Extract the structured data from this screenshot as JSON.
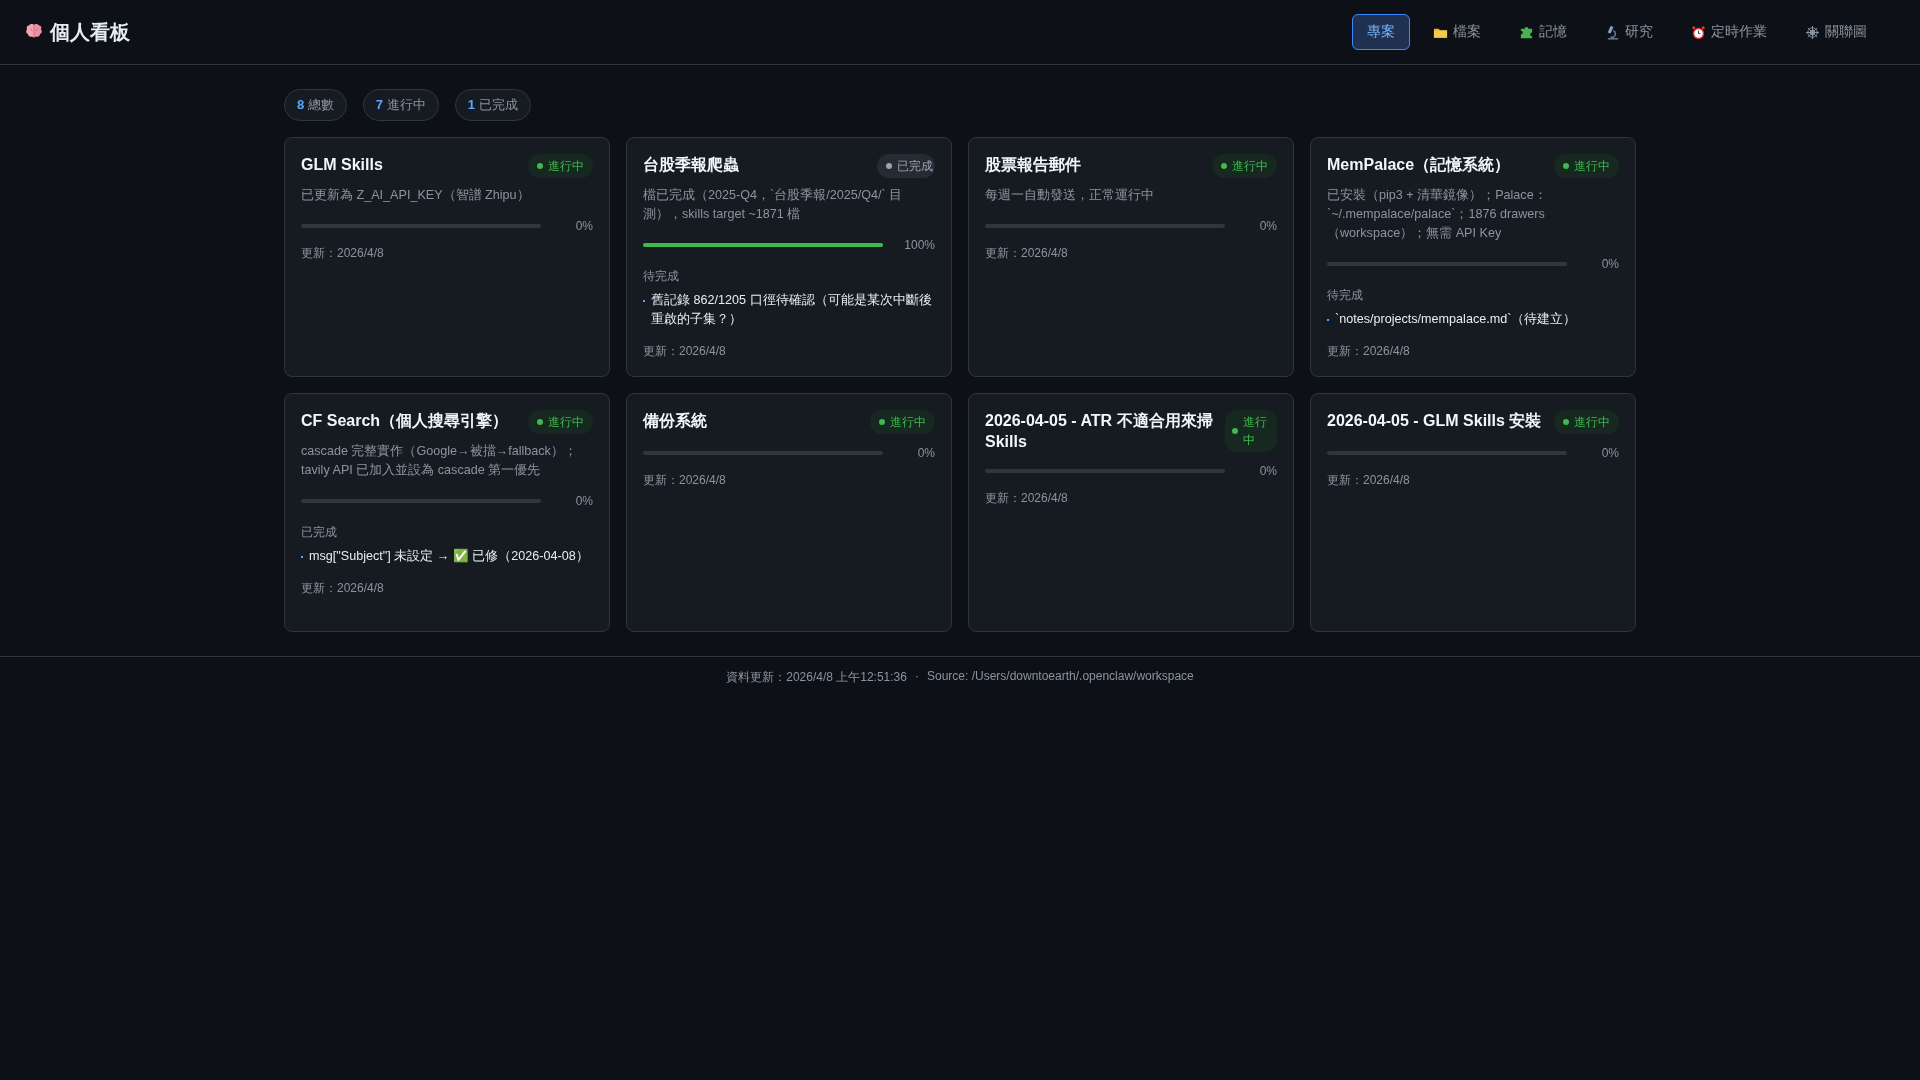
{
  "header": {
    "title": "個人看板"
  },
  "nav": [
    {
      "label": "專案",
      "selected": true
    },
    {
      "label": "檔案",
      "selected": false
    },
    {
      "label": "記憶",
      "selected": false
    },
    {
      "label": "研究",
      "selected": false
    },
    {
      "label": "定時作業",
      "selected": false
    },
    {
      "label": "關聯圖",
      "selected": false
    }
  ],
  "stats": [
    {
      "count": "8",
      "label": "總數"
    },
    {
      "count": "7",
      "label": "進行中"
    },
    {
      "count": "1",
      "label": "已完成"
    }
  ],
  "projects": [
    {
      "title": "GLM Skills",
      "status": {
        "label": "進行中",
        "kind": "active"
      },
      "description": "已更新為 Z_AI_API_KEY（智譜 Zhipu）",
      "level": 0,
      "percent": "0%",
      "updated": "更新：2026/4/8"
    },
    {
      "title": "台股季報爬蟲",
      "status": {
        "label": "已完成",
        "kind": "done"
      },
      "description": "檔已完成（2025-Q4，`台股季報/2025/Q4/` 目測），skills target ~1871 檔",
      "level": 1,
      "percent": "100%",
      "section": {
        "label": "待完成",
        "items": [
          "舊記錄 862/1205 口徑待確認（可能是某次中斷後重啟的子集？）"
        ]
      },
      "updated": "更新：2026/4/8"
    },
    {
      "title": "股票報告郵件",
      "status": {
        "label": "進行中",
        "kind": "active"
      },
      "description": "每週一自動發送，正常運行中",
      "level": 0,
      "percent": "0%",
      "updated": "更新：2026/4/8"
    },
    {
      "title": "MemPalace（記憶系統）",
      "status": {
        "label": "進行中",
        "kind": "active"
      },
      "description": "已安裝（pip3 + 清華鏡像）；Palace：`~/.mempalace/palace`；1876 drawers（workspace）；無需 API Key",
      "level": 0,
      "percent": "0%",
      "section": {
        "label": "待完成",
        "items": [
          "`notes/projects/mempalace.md`（待建立）"
        ]
      },
      "updated": "更新：2026/4/8"
    },
    {
      "title": "CF Search（個人搜尋引擎）",
      "status": {
        "label": "進行中",
        "kind": "active"
      },
      "description": "cascade 完整實作（Google→被擋→fallback）；tavily API 已加入並設為 cascade 第一優先",
      "level": 0,
      "percent": "0%",
      "section": {
        "label": "已完成",
        "items": [
          "msg[\"Subject\"] 未設定 → ✅ 已修（2026-04-08）"
        ]
      },
      "updated": "更新：2026/4/8"
    },
    {
      "title": "備份系統",
      "status": {
        "label": "進行中",
        "kind": "active"
      },
      "level": 0,
      "percent": "0%",
      "updated": "更新：2026/4/8"
    },
    {
      "title": "2026-04-05 - ATR 不適合用來掃 Skills",
      "status": {
        "label": "進行中",
        "kind": "active"
      },
      "level": 0,
      "percent": "0%",
      "updated": "更新：2026/4/8"
    },
    {
      "title": "2026-04-05 - GLM Skills 安裝",
      "status": {
        "label": "進行中",
        "kind": "active"
      },
      "level": 0,
      "percent": "0%",
      "updated": "更新：2026/4/8"
    }
  ],
  "footer": {
    "updated": "資料更新：2026/4/8 上午12:51:36",
    "separator": "·",
    "source": "Source: /Users/downtoearth/.openclaw/workspace"
  }
}
